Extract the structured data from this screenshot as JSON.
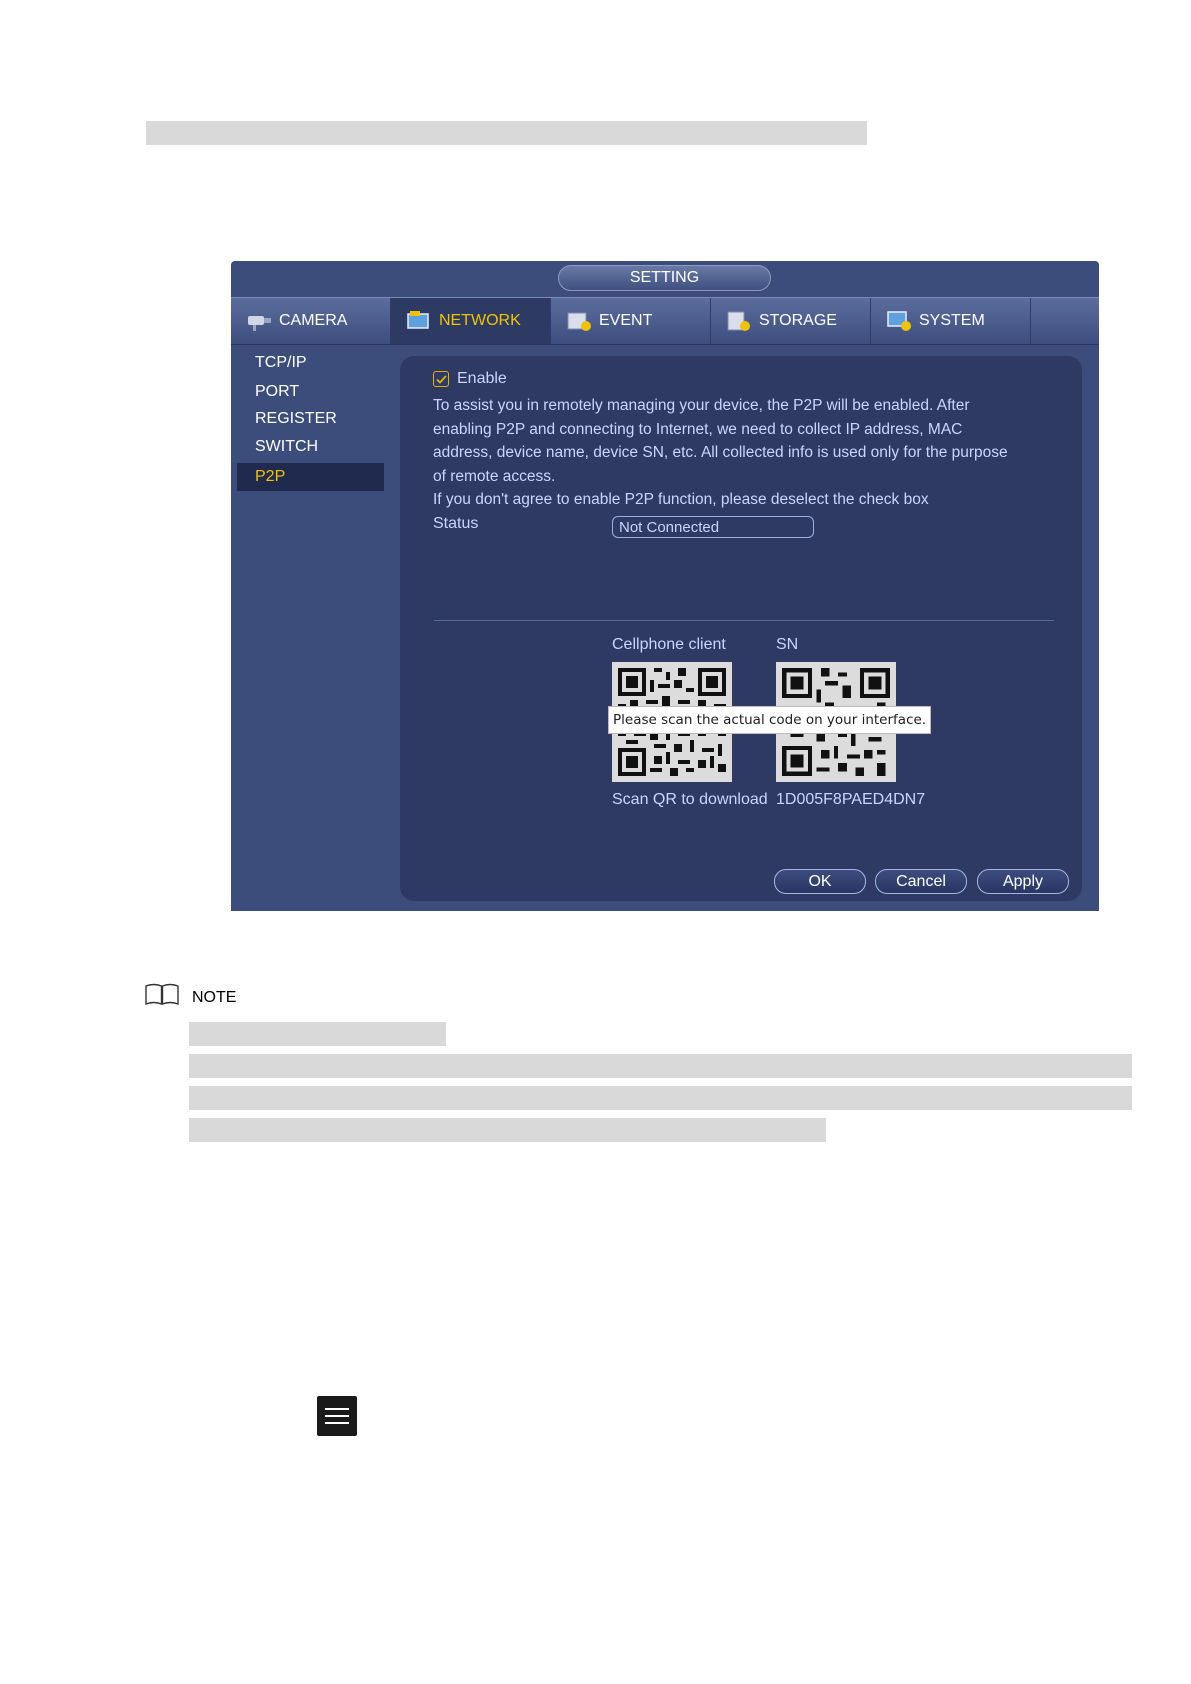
{
  "window": {
    "title": "SETTING"
  },
  "tabs": [
    {
      "label": "CAMERA",
      "icon": "camera-icon",
      "active": false
    },
    {
      "label": "NETWORK",
      "icon": "network-icon",
      "active": true
    },
    {
      "label": "EVENT",
      "icon": "event-icon",
      "active": false
    },
    {
      "label": "STORAGE",
      "icon": "storage-icon",
      "active": false
    },
    {
      "label": "SYSTEM",
      "icon": "system-icon",
      "active": false
    }
  ],
  "sidebar": {
    "items": [
      {
        "label": "TCP/IP",
        "active": false
      },
      {
        "label": "PORT",
        "active": false
      },
      {
        "label": "REGISTER",
        "active": false
      },
      {
        "label": "SWITCH",
        "active": false
      },
      {
        "label": "P2P",
        "active": true
      }
    ]
  },
  "p2p": {
    "enable_label": "Enable",
    "enable_checked": true,
    "notice_lines": [
      "To assist you in remotely managing your device, the P2P will be enabled. After",
      "enabling P2P and connecting to Internet, we need to collect  IP address, MAC",
      "address, device name, device SN, etc. All collected info is used only for the purpose",
      "of remote access.",
      "If you don't agree to enable P2P function, please deselect the check box"
    ],
    "status_label": "Status",
    "status_value": "Not Connected",
    "cellphone_client_label": "Cellphone client",
    "sn_label": "SN",
    "qr_overlay_note": "Please scan the actual code on your interface.",
    "scan_label": "Scan QR to download",
    "sn_value": "1D005F8PAED4DN7"
  },
  "buttons": {
    "ok": "OK",
    "cancel": "Cancel",
    "apply": "Apply"
  },
  "note": {
    "title": "NOTE",
    "icon": "book-icon"
  },
  "colors": {
    "window_bg": "#3c4d7c",
    "panel_bg": "#2e3a64",
    "panel_text": "#c9d5ff",
    "active_accent": "#f2c400"
  }
}
